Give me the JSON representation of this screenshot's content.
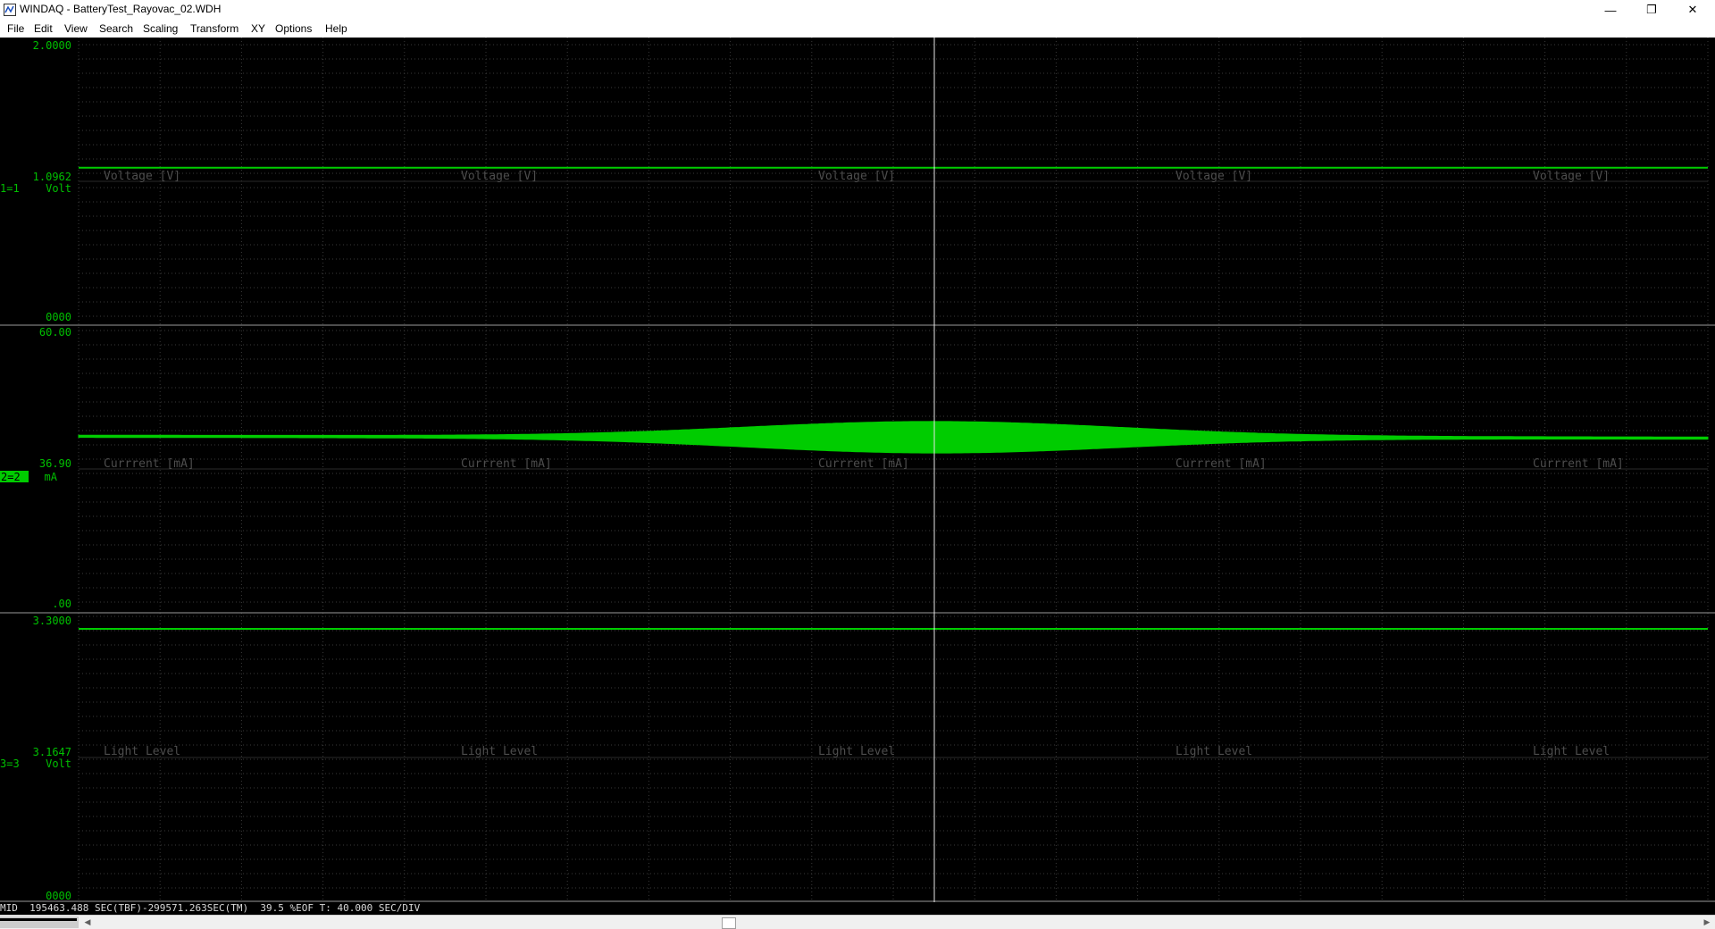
{
  "window": {
    "title": "WINDAQ - BatteryTest_Rayovac_02.WDH",
    "minimize_glyph": "—",
    "restore_glyph": "❐",
    "close_glyph": "✕"
  },
  "menu": [
    "File",
    "Edit",
    "View",
    "Search",
    "Scaling",
    "Transform",
    "XY",
    "Options",
    "Help"
  ],
  "colors": {
    "background": "#000000",
    "trace": "#00cc00",
    "grid": "#3a3a3a",
    "channel_label_text": "#4d4d4d",
    "scale_text": "#00c000",
    "status_text": "#d8d8d8"
  },
  "channels": [
    {
      "top_value": "2.0000",
      "mid_value": "1.0962",
      "channel_id": "1=1",
      "unit": "Volt",
      "bottom_value": "0000",
      "label": "Voltage [V]",
      "selected": false,
      "trace_level": 1.0962,
      "range": [
        0,
        2.0
      ]
    },
    {
      "top_value": "60.00",
      "mid_value": "36.90",
      "channel_id": "2=2",
      "unit": "mA",
      "bottom_value": ".00",
      "label": "Currrent [mA]",
      "selected": true,
      "trace_level": 36.9,
      "range": [
        0,
        60.0
      ],
      "envelope_peak_halfwidth": 3.1
    },
    {
      "top_value": "3.3000",
      "mid_value": "3.1647",
      "channel_id": "3=3",
      "unit": "Volt",
      "bottom_value": "0000",
      "label": "Light Level",
      "selected": false,
      "trace_level": 3.2865,
      "range": [
        3.03,
        3.3
      ]
    }
  ],
  "status": {
    "text": "MID  195463.488 SEC(TBF)-299571.263SEC(TM)  39.5 %EOF T: 40.000 SEC/DIV"
  },
  "scrollbar": {
    "left_arrow": "◀",
    "right_arrow": "▶"
  }
}
